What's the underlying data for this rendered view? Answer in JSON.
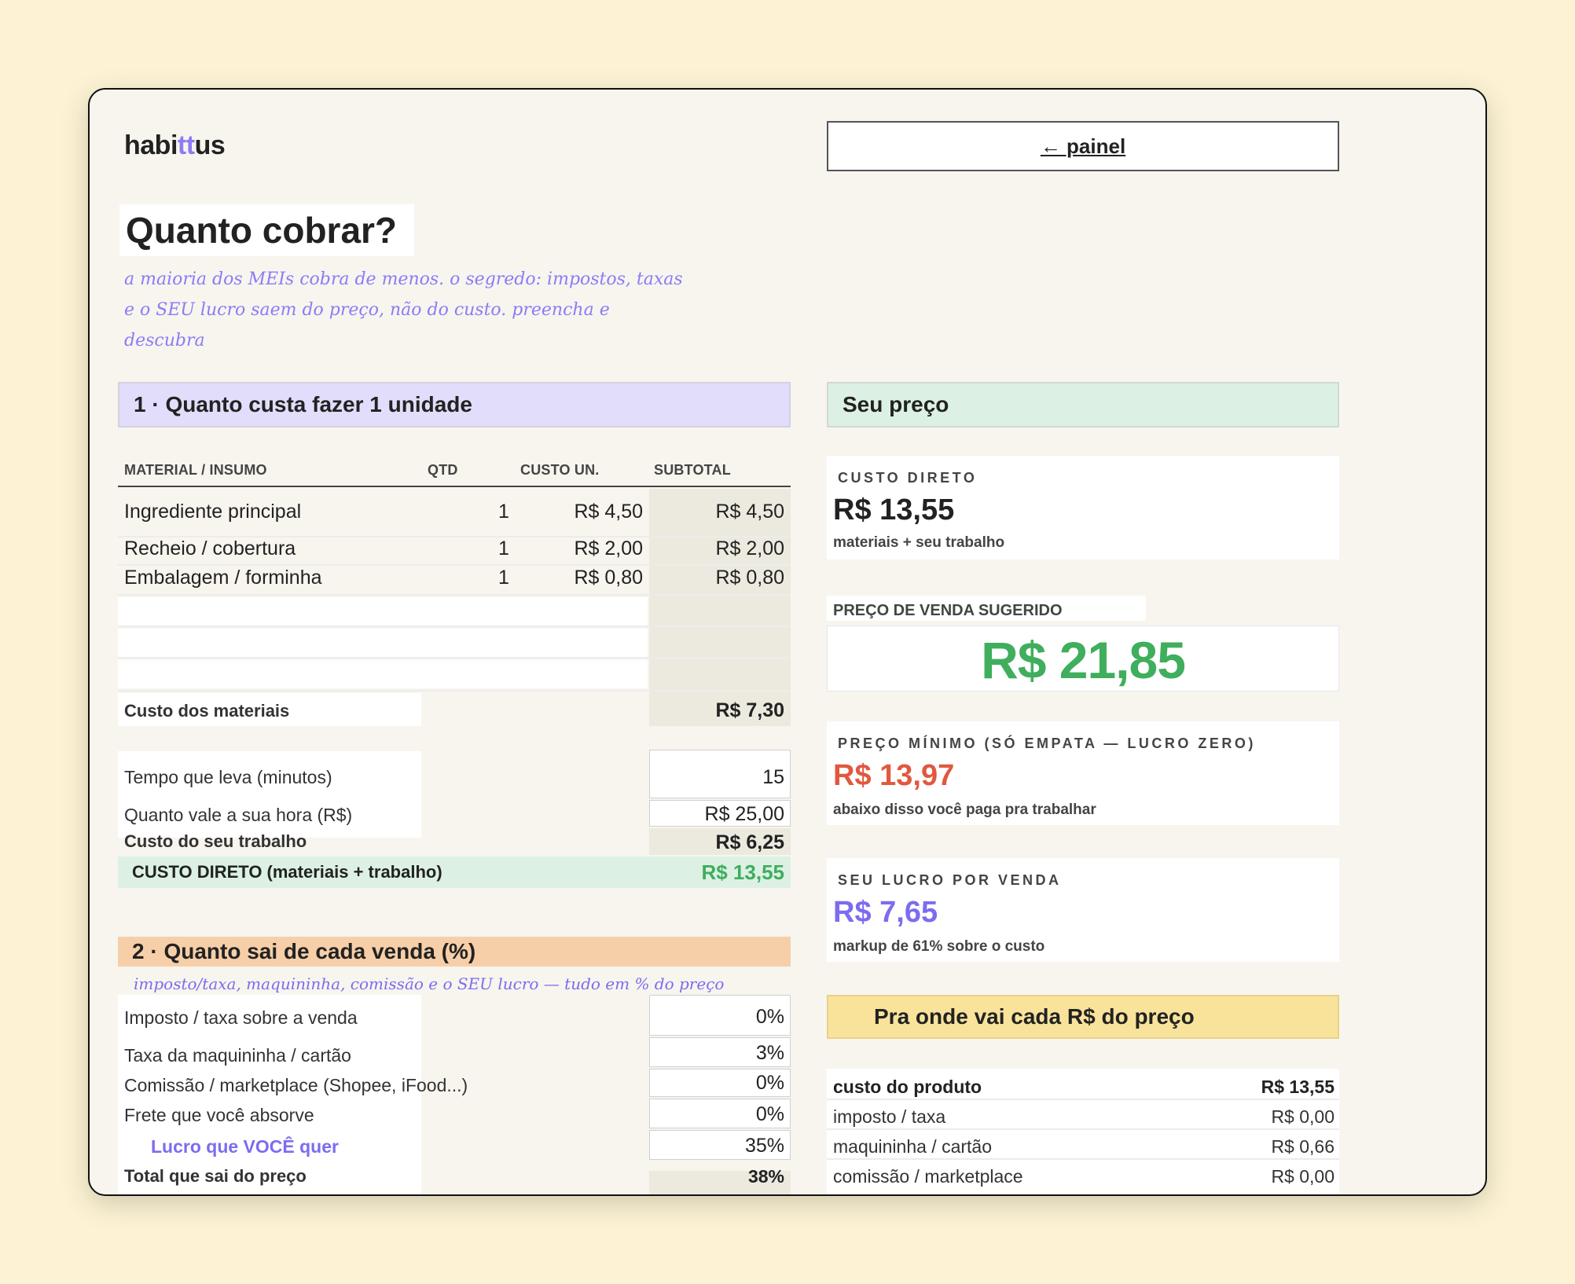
{
  "brand": {
    "pre": "habi",
    "mid": "tt",
    "post": "us"
  },
  "nav": {
    "back_label": "← painel"
  },
  "page": {
    "title": "Quanto cobrar?",
    "subtitle_line1": "a maioria dos MEIs cobra de menos. o segredo: impostos, taxas",
    "subtitle_line2": "e o SEU lucro saem do preço, não do custo. preencha e descubra"
  },
  "section1": {
    "title": "1 · Quanto custa fazer 1 unidade",
    "columns": [
      "MATERIAL / INSUMO",
      "QTD",
      "CUSTO UN.",
      "SUBTOTAL"
    ],
    "rows": [
      {
        "name": "Ingrediente principal",
        "qty": "1",
        "unit": "R$ 4,50",
        "subtotal": "R$ 4,50"
      },
      {
        "name": "Recheio / cobertura",
        "qty": "1",
        "unit": "R$ 2,00",
        "subtotal": "R$ 2,00"
      },
      {
        "name": "Embalagem / forminha",
        "qty": "1",
        "unit": "R$ 0,80",
        "subtotal": "R$ 0,80"
      }
    ],
    "materials_label": "Custo dos materiais",
    "materials_value": "R$ 7,30",
    "time_label": "Tempo que leva (minutos)",
    "time_value": "15",
    "hour_label": "Quanto vale a sua hora (R$)",
    "hour_value": "R$ 25,00",
    "labor_label": "Custo do seu trabalho",
    "labor_value": "R$ 6,25",
    "direct_label": "CUSTO DIRETO (materiais + trabalho)",
    "direct_value": "R$ 13,55"
  },
  "section2": {
    "title": "2 · Quanto sai de cada venda (%)",
    "note": "imposto/taxa, maquininha, comissão e o SEU lucro — tudo em % do preço",
    "rows": [
      {
        "label": "Imposto / taxa sobre a venda",
        "value": "0%"
      },
      {
        "label": "Taxa da maquininha / cartão",
        "value": "3%"
      },
      {
        "label": "Comissão / marketplace (Shopee, iFood...)",
        "value": "0%"
      },
      {
        "label": "Frete que você absorve",
        "value": "0%"
      },
      {
        "label": "Lucro que VOCÊ quer",
        "value": "35%"
      }
    ],
    "total_label": "Total que sai do preço",
    "total_value": "38%"
  },
  "price": {
    "title": "Seu preço",
    "direct_cost_label": "CUSTO DIRETO",
    "direct_cost_value": "R$ 13,55",
    "direct_cost_note": "materiais + seu trabalho",
    "suggested_label": "PREÇO DE VENDA SUGERIDO",
    "suggested_value": "R$ 21,85",
    "min_label": "PREÇO MÍNIMO (SÓ EMPATA — LUCRO ZERO)",
    "min_value": "R$ 13,97",
    "min_note": "abaixo disso você paga pra trabalhar",
    "profit_label": "SEU LUCRO POR VENDA",
    "profit_value": "R$ 7,65",
    "profit_note": "markup de 61% sobre o custo"
  },
  "breakdown": {
    "title": "Pra onde vai cada R$ do preço",
    "rows": [
      {
        "label": "custo do produto",
        "value": "R$ 13,55"
      },
      {
        "label": "imposto / taxa",
        "value": "R$ 0,00"
      },
      {
        "label": "maquininha / cartão",
        "value": "R$ 0,66"
      },
      {
        "label": "comissão / marketplace",
        "value": "R$ 0,00"
      }
    ]
  },
  "colors": {
    "accent_purple": "#8b7cf6",
    "accent_green": "#3fae5d",
    "accent_red": "#e0593f",
    "section1_bg": "#e2ddfa",
    "section2_bg": "#f6cfa8",
    "price_bg": "#dcf1e4",
    "breakdown_bg": "#f9e39b"
  }
}
